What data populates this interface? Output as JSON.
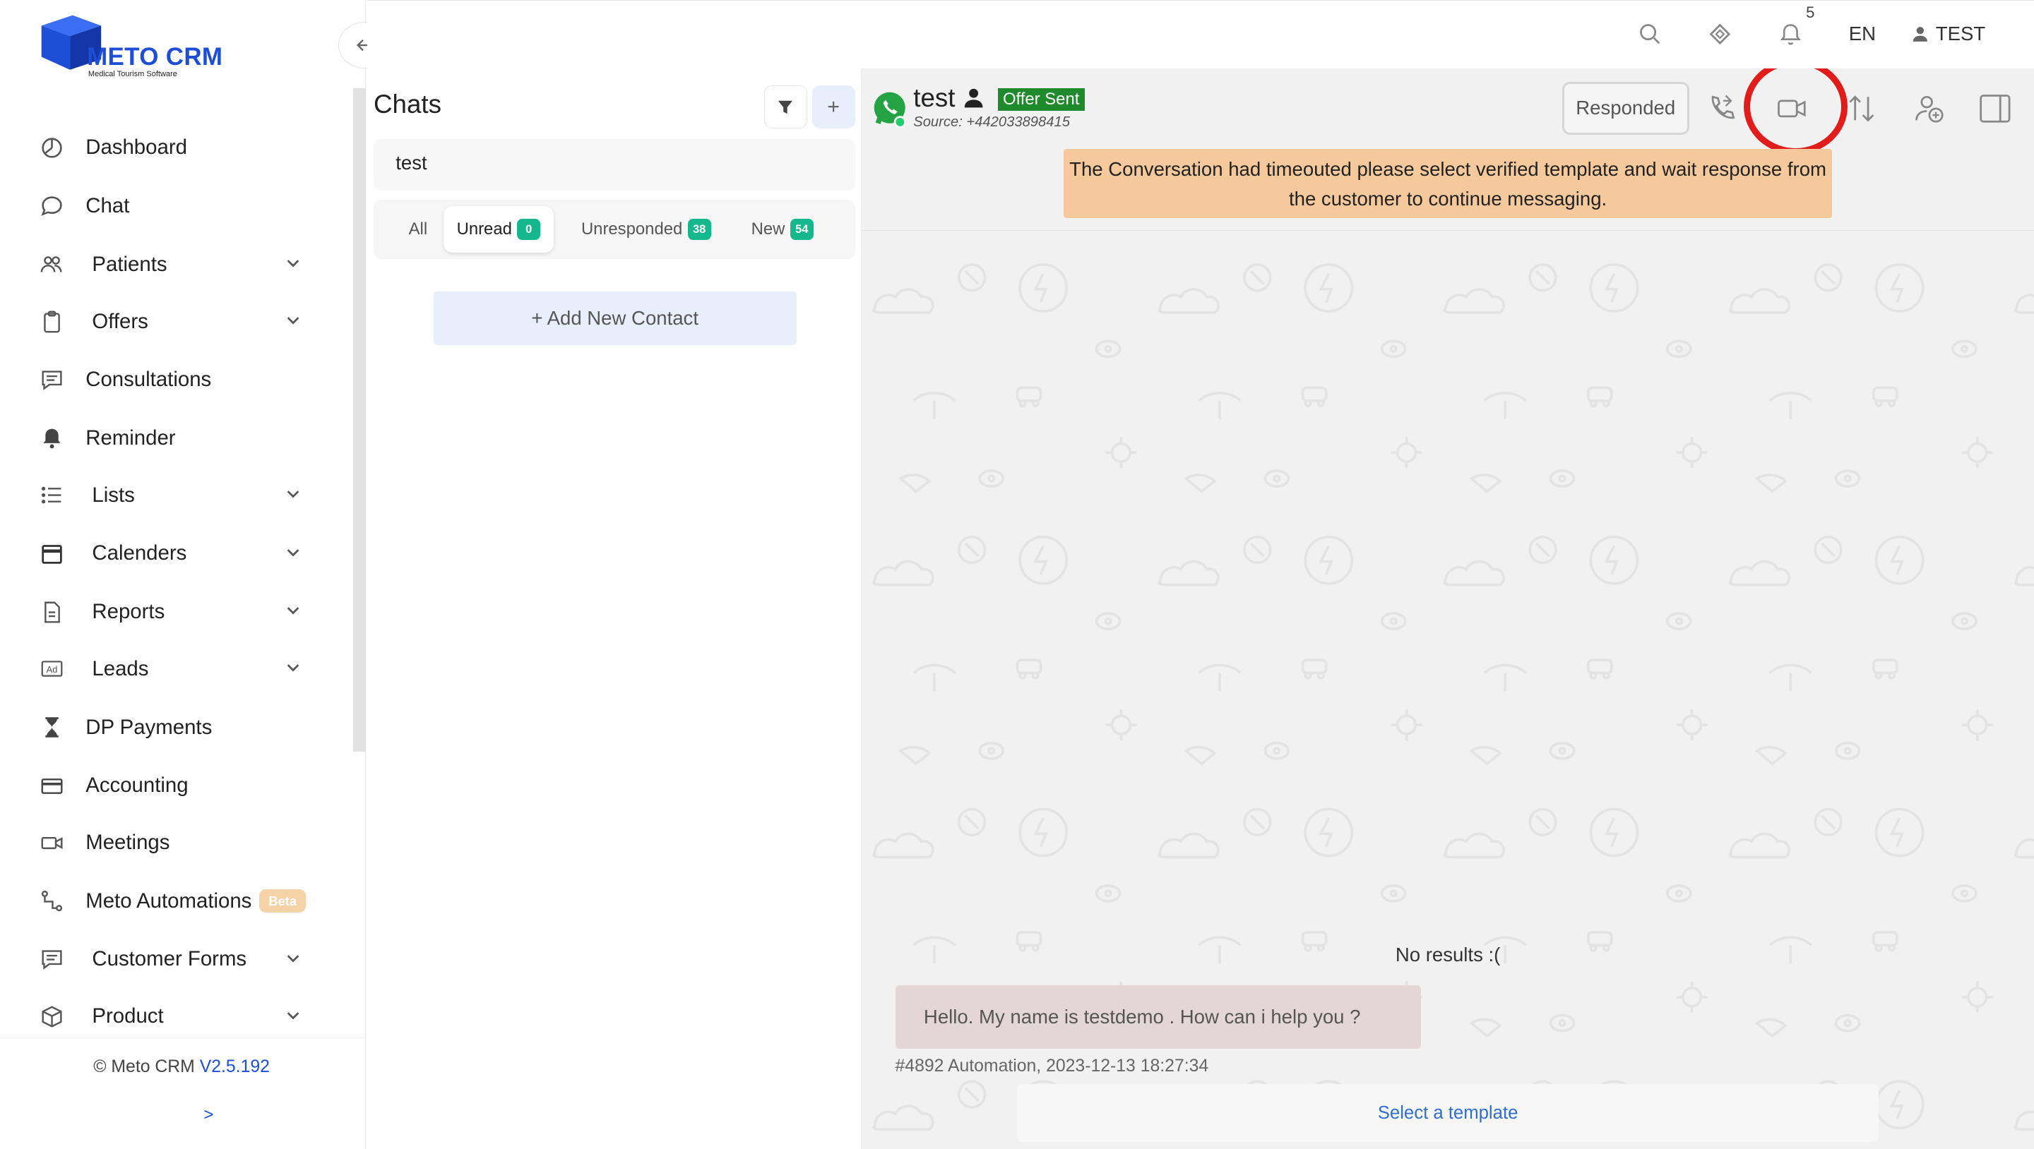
{
  "brand": {
    "name": "METO CRM",
    "tagline": "Medical Tourism Software"
  },
  "topbar": {
    "notification_count": "5",
    "language": "EN",
    "user": "TEST"
  },
  "sidebar": {
    "items": [
      {
        "label": "Dashboard"
      },
      {
        "label": "Chat"
      },
      {
        "label": "Patients"
      },
      {
        "label": "Offers"
      },
      {
        "label": "Consultations"
      },
      {
        "label": "Reminder"
      },
      {
        "label": "Lists"
      },
      {
        "label": "Calenders"
      },
      {
        "label": "Reports"
      },
      {
        "label": "Leads"
      },
      {
        "label": "DP Payments"
      },
      {
        "label": "Accounting"
      },
      {
        "label": "Meetings"
      },
      {
        "label": "Meto Automations",
        "badge": "Beta"
      },
      {
        "label": "Customer Forms"
      },
      {
        "label": "Product"
      }
    ],
    "footer": {
      "copyright": "© Meto CRM",
      "version": "V2.5.192",
      "expand": ">"
    }
  },
  "chats": {
    "title": "Chats",
    "search_value": "test",
    "tabs": [
      {
        "label": "All"
      },
      {
        "label": "Unread",
        "count": "0"
      },
      {
        "label": "Unresponded",
        "count": "38"
      },
      {
        "label": "New",
        "count": "54"
      }
    ],
    "add_contact": "+ Add New Contact"
  },
  "conversation": {
    "contact_name": "test",
    "status_badge": "Offer Sent",
    "source": "Source: +442033898415",
    "responded_label": "Responded",
    "timeout_banner": "The Conversation had timeouted please select verified template and wait response from the customer to continue messaging.",
    "no_results": "No results :(",
    "message": "Hello. My name is testdemo . How can i help you ?",
    "message_meta": "#4892 Automation, 2023-12-13 18:27:34",
    "template_cta": "Select a template"
  },
  "colors": {
    "accent": "#1d4ed8",
    "badge_green": "#14b88c",
    "offer_green": "#1f8a2b",
    "banner": "#f5c99b",
    "highlight": "#e21b1b"
  }
}
